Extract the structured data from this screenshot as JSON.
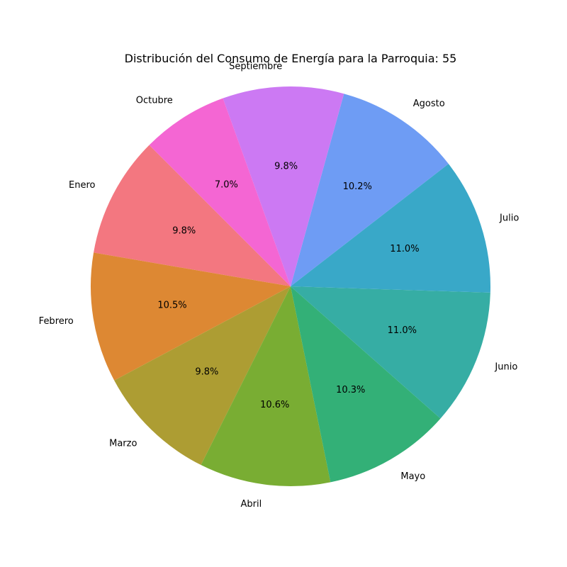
{
  "chart_data": {
    "type": "pie",
    "title": "Distribución del Consumo de Energía para la Parroquia: 55",
    "start_angle_deg": 135,
    "direction": "counterclockwise",
    "slices": [
      {
        "label": "Enero",
        "percent": 9.8,
        "percent_label": "9.8%",
        "color": "#f37780"
      },
      {
        "label": "Febrero",
        "percent": 10.5,
        "percent_label": "10.5%",
        "color": "#dd8833"
      },
      {
        "label": "Marzo",
        "percent": 9.8,
        "percent_label": "9.8%",
        "color": "#ad9d33"
      },
      {
        "label": "Abril",
        "percent": 10.6,
        "percent_label": "10.6%",
        "color": "#79ad33"
      },
      {
        "label": "Mayo",
        "percent": 10.3,
        "percent_label": "10.3%",
        "color": "#33b077"
      },
      {
        "label": "Junio",
        "percent": 11.0,
        "percent_label": "11.0%",
        "color": "#36ada4"
      },
      {
        "label": "Julio",
        "percent": 11.0,
        "percent_label": "11.0%",
        "color": "#39a8c8"
      },
      {
        "label": "Agosto",
        "percent": 10.2,
        "percent_label": "10.2%",
        "color": "#6e9cf4"
      },
      {
        "label": "Septiembre",
        "percent": 9.8,
        "percent_label": "9.8%",
        "color": "#cc79f3"
      },
      {
        "label": "Octubre",
        "percent": 7.0,
        "percent_label": "7.0%",
        "color": "#f466d3"
      }
    ]
  }
}
